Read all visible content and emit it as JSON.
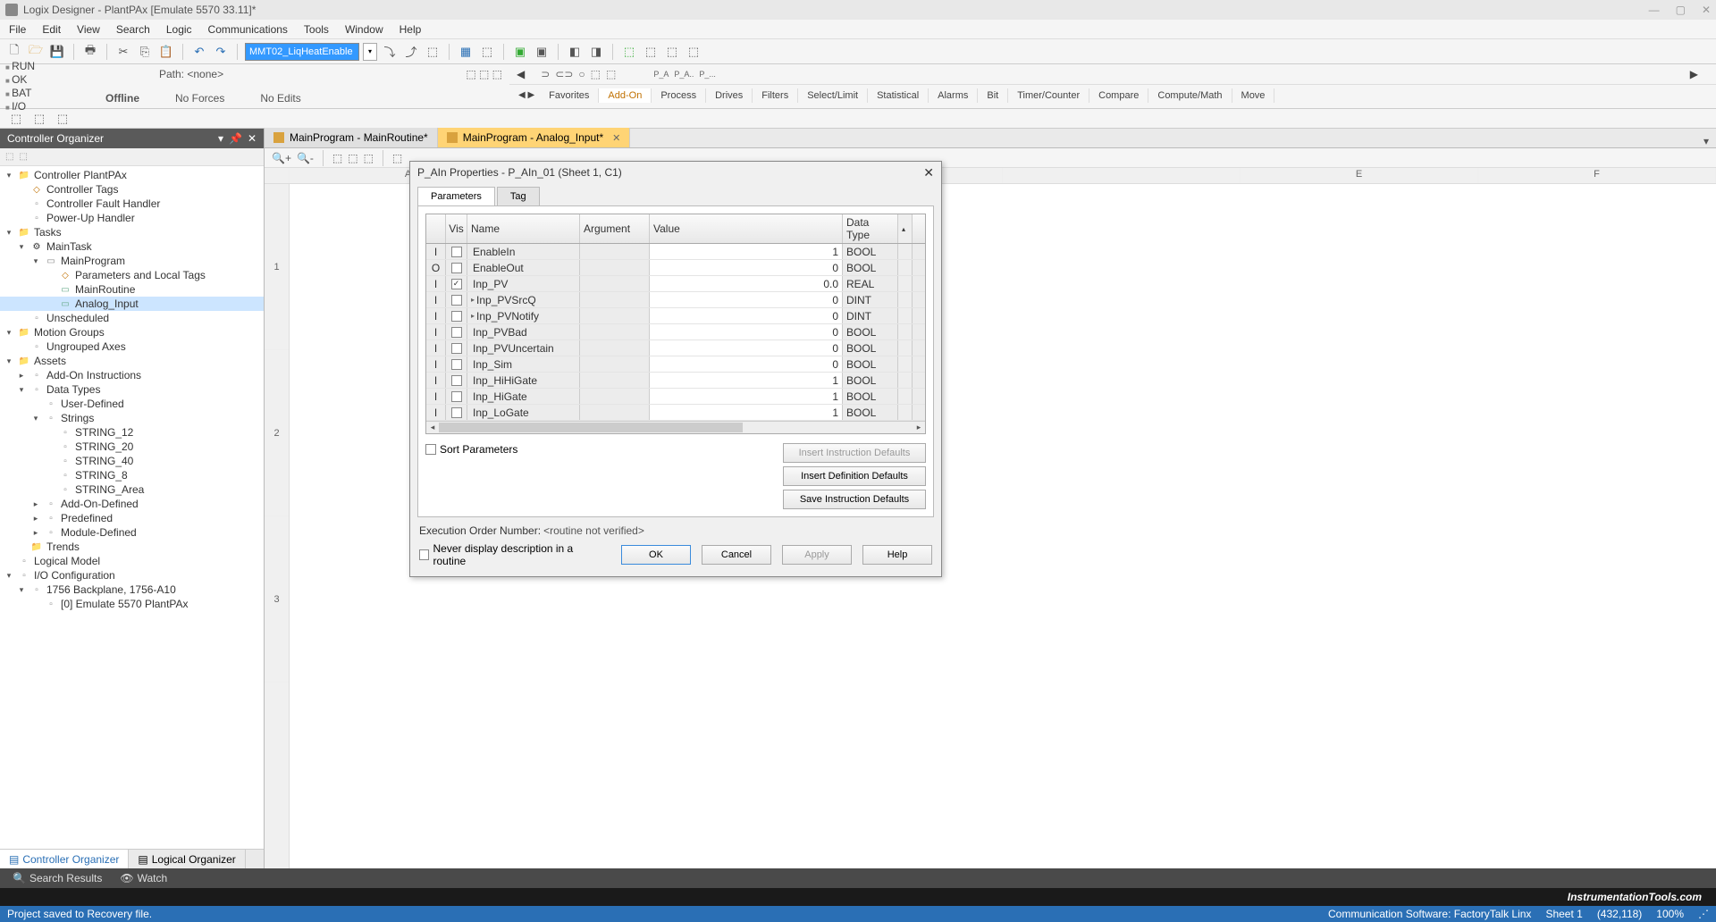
{
  "window": {
    "title": "Logix Designer - PlantPAx [Emulate 5570 33.11]*"
  },
  "menu": [
    "File",
    "Edit",
    "View",
    "Search",
    "Logic",
    "Communications",
    "Tools",
    "Window",
    "Help"
  ],
  "tag_input": "MMT02_LiqHeatEnable",
  "status": {
    "lines": [
      "RUN",
      "OK",
      "BAT",
      "I/O"
    ],
    "offline": "Offline",
    "path_label": "Path:",
    "path_value": "<none>",
    "no_forces": "No Forces",
    "no_edits": "No Edits"
  },
  "categories": [
    "Favorites",
    "Add-On",
    "Process",
    "Drives",
    "Filters",
    "Select/Limit",
    "Statistical",
    "Alarms",
    "Bit",
    "Timer/Counter",
    "Compare",
    "Compute/Math",
    "Move"
  ],
  "categories_active": 1,
  "organizer": {
    "title": "Controller Organizer",
    "tabs": {
      "ctrl": "Controller Organizer",
      "logical": "Logical Organizer"
    },
    "tree": [
      {
        "ind": 0,
        "tog": "▾",
        "icon": "folder",
        "label": "Controller PlantPAx"
      },
      {
        "ind": 1,
        "tog": "",
        "icon": "tag",
        "label": "Controller Tags"
      },
      {
        "ind": 1,
        "tog": "",
        "icon": "ctrl",
        "label": "Controller Fault Handler"
      },
      {
        "ind": 1,
        "tog": "",
        "icon": "ctrl",
        "label": "Power-Up Handler"
      },
      {
        "ind": 0,
        "tog": "▾",
        "icon": "folder",
        "label": "Tasks"
      },
      {
        "ind": 1,
        "tog": "▾",
        "icon": "task",
        "label": "MainTask"
      },
      {
        "ind": 2,
        "tog": "▾",
        "icon": "prog",
        "label": "MainProgram"
      },
      {
        "ind": 3,
        "tog": "",
        "icon": "tag",
        "label": "Parameters and Local Tags"
      },
      {
        "ind": 3,
        "tog": "",
        "icon": "routine",
        "label": "MainRoutine"
      },
      {
        "ind": 3,
        "tog": "",
        "icon": "routine",
        "label": "Analog_Input",
        "selected": true
      },
      {
        "ind": 1,
        "tog": "",
        "icon": "ctrl",
        "label": "Unscheduled"
      },
      {
        "ind": 0,
        "tog": "▾",
        "icon": "folder",
        "label": "Motion Groups"
      },
      {
        "ind": 1,
        "tog": "",
        "icon": "ctrl",
        "label": "Ungrouped Axes"
      },
      {
        "ind": 0,
        "tog": "▾",
        "icon": "folder",
        "label": "Assets"
      },
      {
        "ind": 1,
        "tog": "▸",
        "icon": "ctrl",
        "label": "Add-On Instructions"
      },
      {
        "ind": 1,
        "tog": "▾",
        "icon": "ctrl",
        "label": "Data Types"
      },
      {
        "ind": 2,
        "tog": "",
        "icon": "string",
        "label": "User-Defined"
      },
      {
        "ind": 2,
        "tog": "▾",
        "icon": "string",
        "label": "Strings"
      },
      {
        "ind": 3,
        "tog": "",
        "icon": "string",
        "label": "STRING_12"
      },
      {
        "ind": 3,
        "tog": "",
        "icon": "string",
        "label": "STRING_20"
      },
      {
        "ind": 3,
        "tog": "",
        "icon": "string",
        "label": "STRING_40"
      },
      {
        "ind": 3,
        "tog": "",
        "icon": "string",
        "label": "STRING_8"
      },
      {
        "ind": 3,
        "tog": "",
        "icon": "string",
        "label": "STRING_Area"
      },
      {
        "ind": 2,
        "tog": "▸",
        "icon": "string",
        "label": "Add-On-Defined"
      },
      {
        "ind": 2,
        "tog": "▸",
        "icon": "string",
        "label": "Predefined"
      },
      {
        "ind": 2,
        "tog": "▸",
        "icon": "string",
        "label": "Module-Defined"
      },
      {
        "ind": 1,
        "tog": "",
        "icon": "folder",
        "label": "Trends"
      },
      {
        "ind": 0,
        "tog": "",
        "icon": "ctrl",
        "label": "Logical Model"
      },
      {
        "ind": 0,
        "tog": "▾",
        "icon": "ctrl",
        "label": "I/O Configuration"
      },
      {
        "ind": 1,
        "tog": "▾",
        "icon": "ctrl",
        "label": "1756 Backplane, 1756-A10"
      },
      {
        "ind": 2,
        "tog": "",
        "icon": "ctrl",
        "label": "[0] Emulate 5570 PlantPAx"
      }
    ]
  },
  "docs": [
    {
      "label": "MainProgram - MainRoutine*",
      "active": false
    },
    {
      "label": "MainProgram - Analog_Input*",
      "active": true
    }
  ],
  "sheet_cols": [
    "A",
    "",
    "",
    "",
    "E",
    "F"
  ],
  "sheet_rows": [
    "1",
    "2",
    "3"
  ],
  "dialog": {
    "title": "P_AIn Properties - P_AIn_01 (Sheet 1, C1)",
    "tabs": [
      "Parameters",
      "Tag"
    ],
    "tabs_active": 0,
    "headers": {
      "vis": "Vis",
      "name": "Name",
      "arg": "Argument",
      "val": "Value",
      "type": "Data Type"
    },
    "rows": [
      {
        "io": "I",
        "vis": false,
        "exp": "",
        "name": "EnableIn",
        "arg": "",
        "val": "1",
        "type": "BOOL"
      },
      {
        "io": "O",
        "vis": false,
        "exp": "",
        "name": "EnableOut",
        "arg": "",
        "val": "0",
        "type": "BOOL"
      },
      {
        "io": "I",
        "vis": true,
        "exp": "",
        "name": "Inp_PV",
        "arg": "",
        "val": "0.0",
        "type": "REAL"
      },
      {
        "io": "I",
        "vis": false,
        "exp": "▸",
        "name": "Inp_PVSrcQ",
        "arg": "",
        "val": "0",
        "type": "DINT"
      },
      {
        "io": "I",
        "vis": false,
        "exp": "▸",
        "name": "Inp_PVNotify",
        "arg": "",
        "val": "0",
        "type": "DINT"
      },
      {
        "io": "I",
        "vis": false,
        "exp": "",
        "name": "Inp_PVBad",
        "arg": "",
        "val": "0",
        "type": "BOOL"
      },
      {
        "io": "I",
        "vis": false,
        "exp": "",
        "name": "Inp_PVUncertain",
        "arg": "",
        "val": "0",
        "type": "BOOL"
      },
      {
        "io": "I",
        "vis": false,
        "exp": "",
        "name": "Inp_Sim",
        "arg": "",
        "val": "0",
        "type": "BOOL"
      },
      {
        "io": "I",
        "vis": false,
        "exp": "",
        "name": "Inp_HiHiGate",
        "arg": "",
        "val": "1",
        "type": "BOOL"
      },
      {
        "io": "I",
        "vis": false,
        "exp": "",
        "name": "Inp_HiGate",
        "arg": "",
        "val": "1",
        "type": "BOOL"
      },
      {
        "io": "I",
        "vis": false,
        "exp": "",
        "name": "Inp_LoGate",
        "arg": "",
        "val": "1",
        "type": "BOOL"
      }
    ],
    "sort": "Sort Parameters",
    "btn_insert_instr": "Insert Instruction Defaults",
    "btn_insert_def": "Insert Definition Defaults",
    "btn_save_instr": "Save Instruction Defaults",
    "exec_label": "Execution Order Number:",
    "exec_val": "<routine not verified>",
    "never_display": "Never display description in a routine",
    "ok": "OK",
    "cancel": "Cancel",
    "apply": "Apply",
    "help": "Help"
  },
  "bottom_tabs": {
    "search": "Search Results",
    "watch": "Watch"
  },
  "branding": "InstrumentationTools.com",
  "statusbar": {
    "left": "Project saved to Recovery file.",
    "comm": "Communication Software: FactoryTalk Linx",
    "sheet": "Sheet 1",
    "coords": "(432,118)",
    "zoom": "100%"
  }
}
